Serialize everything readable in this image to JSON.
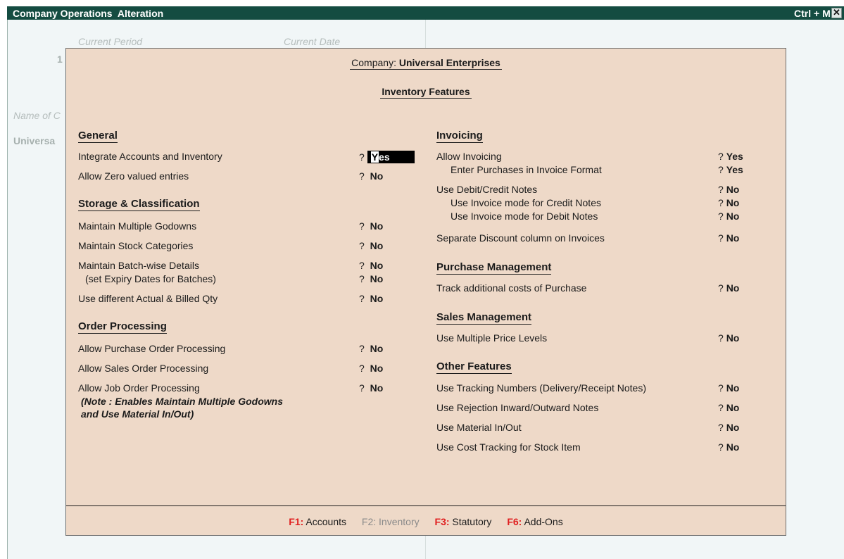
{
  "window": {
    "title": "Company Operations  Alteration",
    "shortcut": "Ctrl + M",
    "close_glyph": "✕"
  },
  "background": {
    "current_period_label": "Current Period",
    "current_date_label": "Current Date",
    "period_fragment": "1",
    "name_label_fragment": "Name of C",
    "company_fragment": "Universa"
  },
  "dialog": {
    "company_label": "Company:",
    "company_name": "Universal Enterprises",
    "heading": "Inventory Features",
    "left": {
      "general": {
        "title": "General",
        "items": [
          {
            "label": "Integrate Accounts and Inventory",
            "value": "Yes"
          },
          {
            "label": "Allow Zero valued entries",
            "value": "No"
          }
        ]
      },
      "storage": {
        "title": "Storage & Classification",
        "items": [
          {
            "label": "Maintain Multiple Godowns",
            "value": "No"
          },
          {
            "label": "Maintain Stock Categories",
            "value": "No"
          },
          {
            "label": "Maintain Batch-wise Details",
            "value": "No"
          },
          {
            "label": "(set Expiry Dates for Batches)",
            "value": "No"
          },
          {
            "label": "Use different Actual & Billed Qty",
            "value": "No"
          }
        ]
      },
      "order": {
        "title": "Order Processing",
        "items": [
          {
            "label": "Allow Purchase Order Processing",
            "value": "No"
          },
          {
            "label": "Allow Sales Order Processing",
            "value": "No"
          },
          {
            "label": "Allow Job Order Processing",
            "value": "No"
          }
        ],
        "note_line1": "(Note : Enables Maintain Multiple Godowns",
        "note_line2": "and Use Material In/Out)"
      }
    },
    "right": {
      "invoicing": {
        "title": "Invoicing",
        "items": [
          {
            "label": "Allow Invoicing",
            "value": "Yes"
          },
          {
            "label": "Enter Purchases in Invoice Format",
            "value": "Yes"
          },
          {
            "label": "Use Debit/Credit Notes",
            "value": "No"
          },
          {
            "label": "Use Invoice mode for Credit Notes",
            "value": "No"
          },
          {
            "label": "Use Invoice mode for Debit Notes",
            "value": "No"
          },
          {
            "label": "Separate Discount column on Invoices",
            "value": "No"
          }
        ]
      },
      "purchase": {
        "title": "Purchase Management",
        "items": [
          {
            "label": "Track additional costs of Purchase",
            "value": "No"
          }
        ]
      },
      "sales": {
        "title": "Sales Management",
        "items": [
          {
            "label": "Use Multiple Price Levels",
            "value": "No"
          }
        ]
      },
      "other": {
        "title": "Other Features",
        "items": [
          {
            "label": "Use Tracking Numbers (Delivery/Receipt Notes)",
            "value": "No"
          },
          {
            "label": "Use Rejection Inward/Outward Notes",
            "value": "No"
          },
          {
            "label": "Use Material In/Out",
            "value": "No"
          },
          {
            "label": "Use Cost Tracking for Stock Item",
            "value": "No"
          }
        ]
      }
    },
    "question_mark": "?",
    "footer": [
      {
        "key": "F1:",
        "label": "Accounts",
        "enabled": true
      },
      {
        "key": "F2:",
        "label": "Inventory",
        "enabled": false
      },
      {
        "key": "F3:",
        "label": "Statutory",
        "enabled": true
      },
      {
        "key": "F6:",
        "label": "Add-Ons",
        "enabled": true
      }
    ]
  },
  "colors": {
    "titlebar": "#144c41",
    "dialog_bg": "#eed9c8",
    "hotkey": "#e02020",
    "disabled": "#8a8a8a"
  }
}
